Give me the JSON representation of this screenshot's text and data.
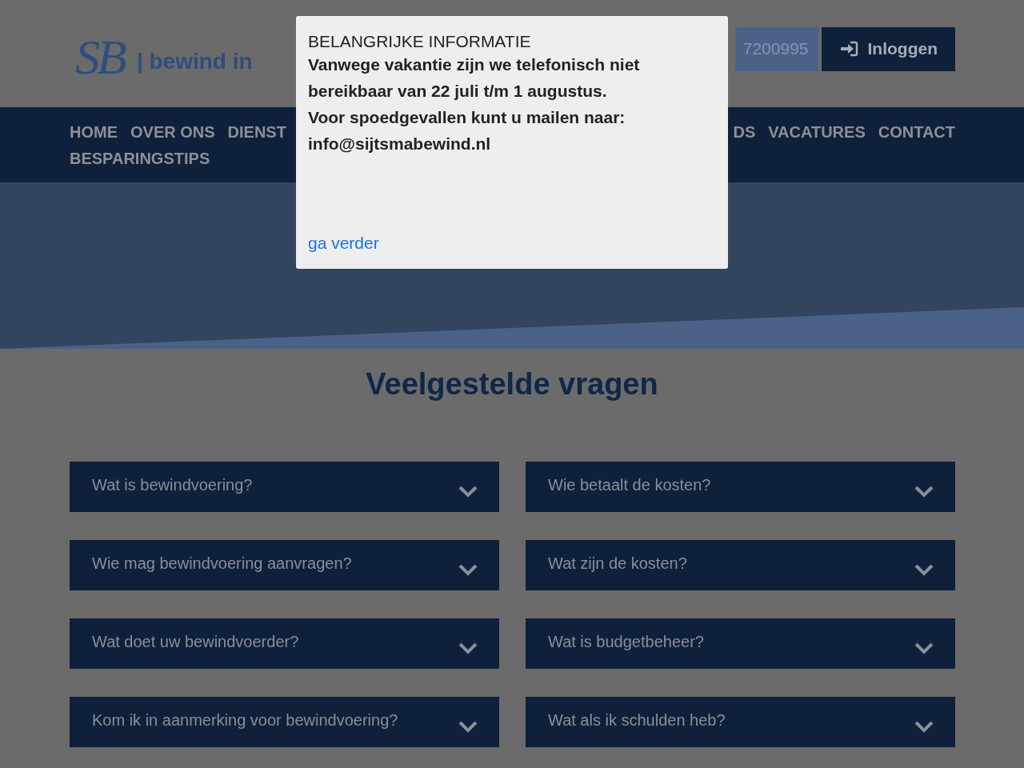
{
  "logo": {
    "monogram": "SB",
    "tagline": "| bewind in"
  },
  "phone": {
    "number": "7200995"
  },
  "login_button": {
    "label": "Inloggen"
  },
  "nav": {
    "left": [
      "HOME",
      "OVER ONS",
      "DIENST"
    ],
    "right": [
      "DS",
      "VACATURES",
      "CONTACT"
    ],
    "second_row": [
      "BESPARINGSTIPS"
    ]
  },
  "page_title": "Veelgestelde vragen",
  "faq": [
    {
      "question": "Wat is bewindvoering?",
      "expanded": false
    },
    {
      "question": "Wie betaalt de kosten?",
      "expanded": false
    },
    {
      "question": "Wie mag bewindvoering aanvragen?",
      "expanded": false
    },
    {
      "question": "Wat zijn de kosten?",
      "expanded": false
    },
    {
      "question": "Wat doet uw bewindvoerder?",
      "expanded": false
    },
    {
      "question": "Wat is budgetbeheer?",
      "expanded": false
    },
    {
      "question": "Kom ik in aanmerking voor bewindvoering?",
      "expanded": false
    },
    {
      "question": "Wat als ik schulden heb?",
      "expanded": false
    }
  ],
  "modal": {
    "title": "BELANGRIJKE INFORMATIE",
    "lines": [
      "Vanwege vakantie zijn we telefonisch niet",
      "bereikbaar van 22 juli t/m 1 augustus.",
      "Voor spoedgevallen kunt u mailen naar:",
      "info@sijtsmabewind.nl"
    ],
    "link": "ga verder"
  }
}
